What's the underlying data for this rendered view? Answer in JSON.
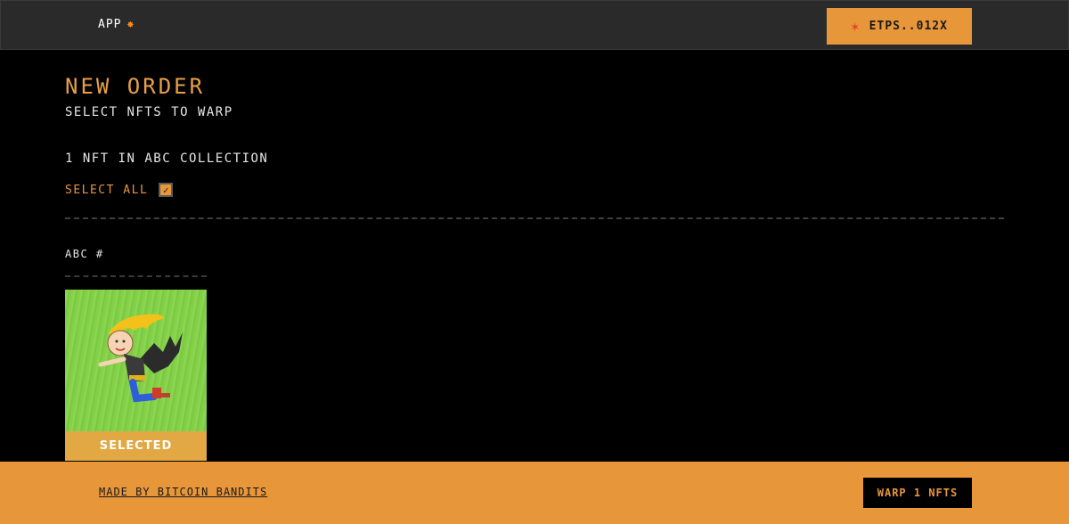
{
  "header": {
    "app_label": "APP",
    "app_icon": "sun-icon",
    "wallet_icon": "burst-icon",
    "wallet_label": "ETPS..012X"
  },
  "main": {
    "title": "NEW ORDER",
    "subtitle": "SELECT NFTS TO WARP",
    "collection_count": "1 NFT IN ABC COLLECTION",
    "select_all_label": "SELECT ALL",
    "select_all_checked": true,
    "collection_name": "ABC #"
  },
  "nfts": [
    {
      "status": "SELECTED",
      "image": "cartoon-flying-kid-with-bat-wings"
    }
  ],
  "footer": {
    "made_by": "MADE BY BITCOIN BANDITS",
    "warp_button": "WARP 1 NFTS"
  },
  "colors": {
    "accent": "#e8963a",
    "title": "#e8a046",
    "topbar": "#2a2a2a",
    "background": "#000000"
  }
}
